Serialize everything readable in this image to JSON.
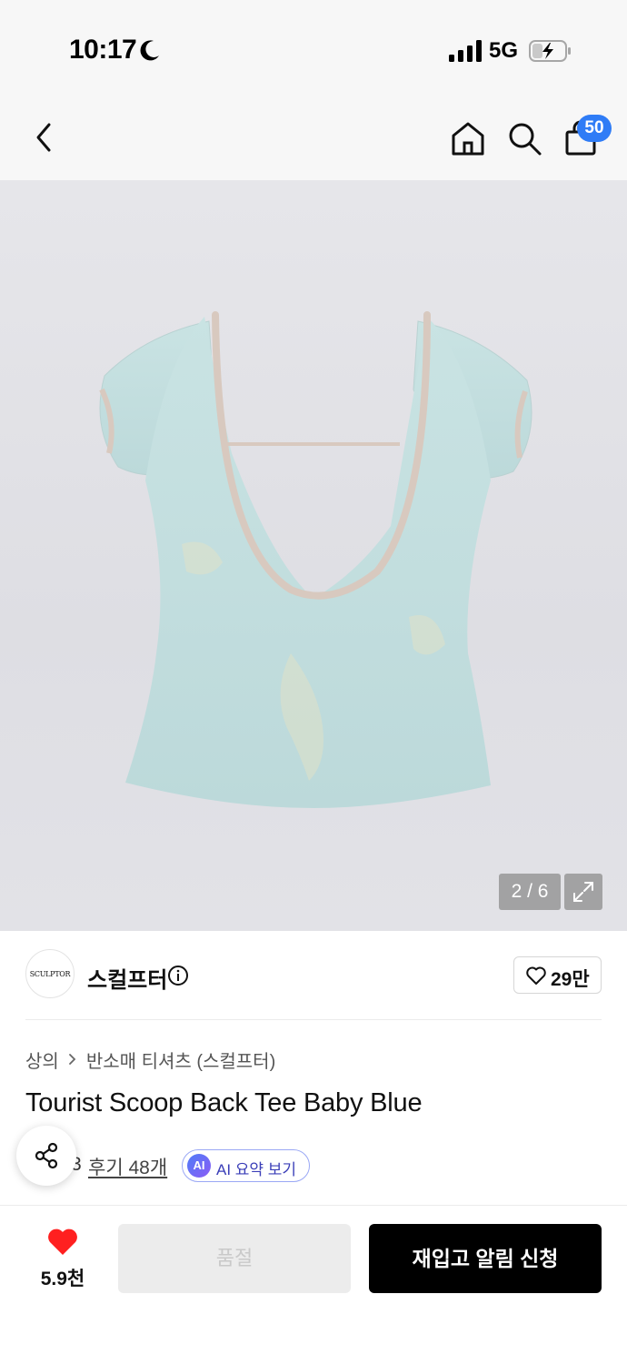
{
  "status_bar": {
    "time": "10:17",
    "network": "5G",
    "icons": [
      "moon-icon",
      "signal-icon",
      "battery-charging-icon"
    ]
  },
  "top_nav": {
    "icons": [
      "back-icon",
      "home-icon",
      "search-icon",
      "shopping-bag-icon"
    ],
    "cart_count": "50"
  },
  "gallery": {
    "page_indicator": "2 / 6",
    "expand_icon": "expand-icon"
  },
  "brand": {
    "logo_text": "SCULPTOR",
    "name": "스컬프터",
    "likes": "29만"
  },
  "product": {
    "breadcrumb": [
      "상의",
      "반소매 티셔츠 (스컬프터)"
    ],
    "title": "Tourist Scoop Back Tee Baby Blue",
    "rating_partial": "3",
    "review_label": "후기 48개",
    "ai_badge": "AI",
    "ai_summary_label": "AI 요약 보기"
  },
  "bottom_bar": {
    "wish_count": "5.9천",
    "soldout_label": "품절",
    "restock_label": "재입고 알림 신청",
    "heart_color": "#ff2020"
  },
  "colors": {
    "accent_badge": "#2f7cf6",
    "ai_text": "#3b3fb8",
    "primary_button": "#000000"
  }
}
